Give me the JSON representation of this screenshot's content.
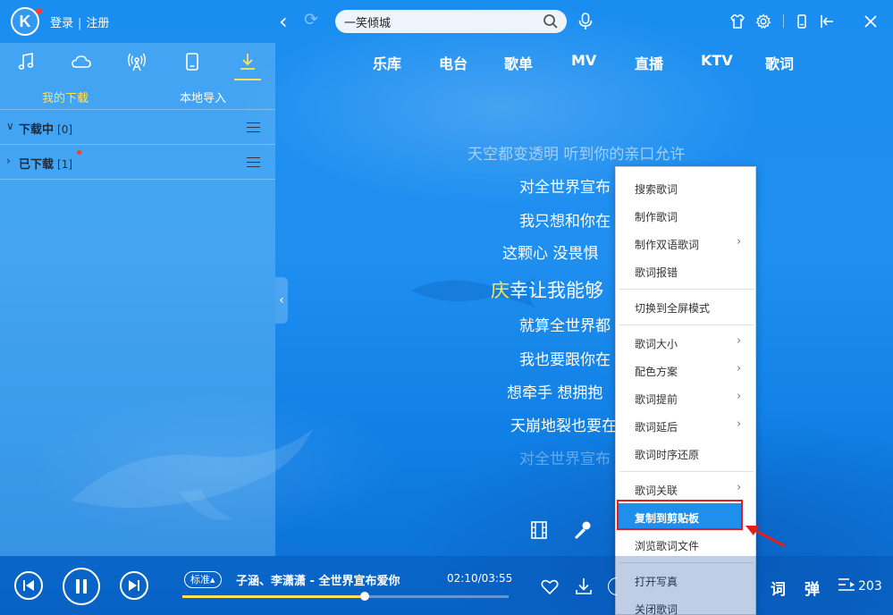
{
  "header": {
    "logo_letter": "K",
    "login": "登录",
    "register": "注册",
    "search_value": "一笑倾城"
  },
  "sidebar": {
    "tabs": [
      {
        "label": "我的下载",
        "active": true
      },
      {
        "label": "本地导入",
        "active": false
      }
    ],
    "sections": [
      {
        "label": "下载中",
        "count": "[0]"
      },
      {
        "label": "已下载",
        "count": "[1]"
      }
    ]
  },
  "nav": [
    "乐库",
    "电台",
    "歌单",
    "MV",
    "直播",
    "KTV",
    "歌词"
  ],
  "lyrics": [
    "天空都变透明 听到你的亲口允许",
    "对全世界宣布",
    "我只想和你在",
    "这颗心 没畏惧",
    "庆",
    "幸让我能够",
    "就算全世界都",
    "我也要跟你在",
    "想牵手 想拥抱",
    "天崩地裂也要在",
    "对全世界宣布"
  ],
  "context_menu": {
    "items": [
      {
        "label": "搜索歌词",
        "submenu": false
      },
      {
        "label": "制作歌词",
        "submenu": false
      },
      {
        "label": "制作双语歌词",
        "submenu": true
      },
      {
        "label": "歌词报错",
        "submenu": false
      },
      {
        "label": "切换到全屏模式",
        "submenu": false
      },
      {
        "label": "歌词大小",
        "submenu": true
      },
      {
        "label": "配色方案",
        "submenu": true
      },
      {
        "label": "歌词提前",
        "submenu": true
      },
      {
        "label": "歌词延后",
        "submenu": true
      },
      {
        "label": "歌词时序还原",
        "submenu": false
      },
      {
        "label": "歌词关联",
        "submenu": true
      },
      {
        "label": "复制到剪贴板",
        "submenu": false,
        "selected": true
      },
      {
        "label": "浏览歌词文件",
        "submenu": false
      },
      {
        "label": "打开写真",
        "submenu": false
      },
      {
        "label": "关闭歌词",
        "submenu": false
      }
    ],
    "arrow_glyph": "›"
  },
  "player": {
    "quality": "标准▴",
    "song": "子涵、李潇潇 - 全世界宣布爱你",
    "time": "02:10/03:55",
    "progress": 0.558,
    "lyric_btn": "词",
    "danmu_btn": "弹",
    "playlist_count": "203"
  },
  "colors": {
    "accent_yellow": "#ffe25a",
    "menu_highlight": "#1e8fea",
    "annotation_red": "#e02020"
  }
}
